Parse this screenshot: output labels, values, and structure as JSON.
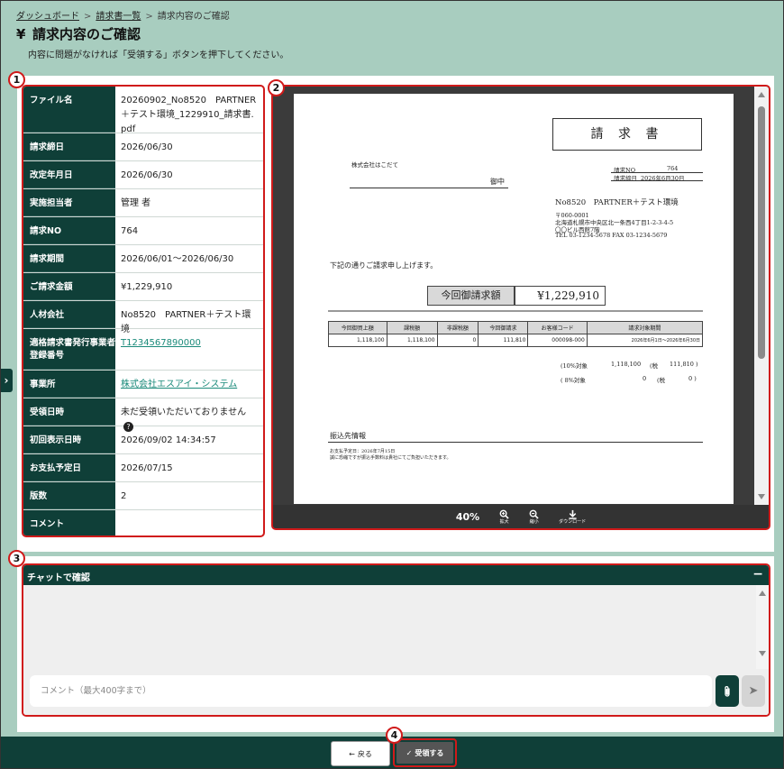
{
  "breadcrumb": {
    "items": [
      {
        "label": "ダッシュボード"
      },
      {
        "label": "請求書一覧"
      },
      {
        "label": "請求内容のご確認"
      }
    ],
    "separator": ">"
  },
  "header": {
    "icon": "yen-icon",
    "icon_glyph": "¥",
    "title": "請求内容のご確認",
    "subtitle": "内容に問題がなければ「受領する」ボタンを押下してください。"
  },
  "badges": [
    "1",
    "2",
    "3",
    "4"
  ],
  "info": {
    "rows": [
      {
        "label": "ファイル名",
        "value": "20260902_No8520　PARTNER＋テスト環境_1229910_請求書.pdf"
      },
      {
        "label": "請求締日",
        "value": "2026/06/30"
      },
      {
        "label": "改定年月日",
        "value": "2026/06/30"
      },
      {
        "label": "実施担当者",
        "value": "管理 者"
      },
      {
        "label": "請求NO",
        "value": "764"
      },
      {
        "label": "請求期間",
        "value": "2026/06/01～2026/06/30"
      },
      {
        "label": "ご請求金額",
        "value": "¥1,229,910"
      },
      {
        "label": "人材会社",
        "value": "No8520　PARTNER＋テスト環境"
      },
      {
        "label": "適格請求書発行事業者登録番号",
        "value": "T1234567890000"
      },
      {
        "label": "事業所",
        "value": "株式会社エスアイ・システム"
      },
      {
        "label": "受領日時",
        "value": "未だ受領いただいておりません"
      },
      {
        "label": "初回表示日時",
        "value": "2026/09/02 14:34:57"
      },
      {
        "label": "お支払予定日",
        "value": "2026/07/15"
      },
      {
        "label": "版数",
        "value": "2"
      },
      {
        "label": "コメント",
        "value": ""
      }
    ]
  },
  "viewer": {
    "zoom": "40%",
    "zoom_in_label": "拡大",
    "zoom_out_label": "縮小",
    "download_label": "ダウンロード"
  },
  "invoice": {
    "title": "請 求 書",
    "recipient_company": "株式会社はこだて",
    "recipient_suffix": "御中",
    "invoice_no_label": "請求NO",
    "invoice_no": "764",
    "closing_label": "請求締日",
    "closing_date": "2026年6月30日",
    "issuer_name": "No8520　PARTNER＋テスト環境",
    "issuer_address_lines": [
      "〒060-0001",
      "北海道札幌市中央区北一条西4丁目1-2-3-4-5",
      "〇〇ビル西館7階",
      "TEL 03-1234-5678 FAX 03-1234-5679"
    ],
    "intro": "下記の通りご請求申し上げます。",
    "amount_label": "今回御請求額",
    "amount": "¥1,229,910",
    "table_headers": [
      "今回御買上額",
      "課税額",
      "非課税額",
      "今回御請求",
      "お客様コード",
      "請求対象期間"
    ],
    "table_row": [
      "1,118,100",
      "1,118,100",
      "0",
      "111,810",
      "000098-000",
      "2026年6月1日～2026年6月30日"
    ],
    "tax_lines": [
      {
        "label": "(10%対象",
        "amount": "1,118,100",
        "tax_label": "(税",
        "tax": "111,810 )"
      },
      {
        "label": "( 8%対象",
        "amount": "0",
        "tax_label": "(税",
        "tax": "0 )"
      }
    ],
    "bank_title": "振込先情報",
    "bank_lines": [
      "お支払予定日：2026年7月15日",
      "誠に恐縮ですが振込手数料は貴社にてご負担いただきます。"
    ]
  },
  "chat": {
    "title": "チャットで確認",
    "collapse_glyph": "−",
    "placeholder": "コメント（最大400字まで）",
    "send_glyph": "➤"
  },
  "footer": {
    "back_label": "戻る",
    "accept_label": "受領する",
    "back_glyph": "←",
    "accept_glyph": "✓"
  },
  "toggle_glyph": "›",
  "help_glyph": "?",
  "colors": {
    "primary": "#0f3f38",
    "background": "#a8cdbf",
    "highlight": "#d01a1a",
    "link": "#1a8a7a"
  }
}
